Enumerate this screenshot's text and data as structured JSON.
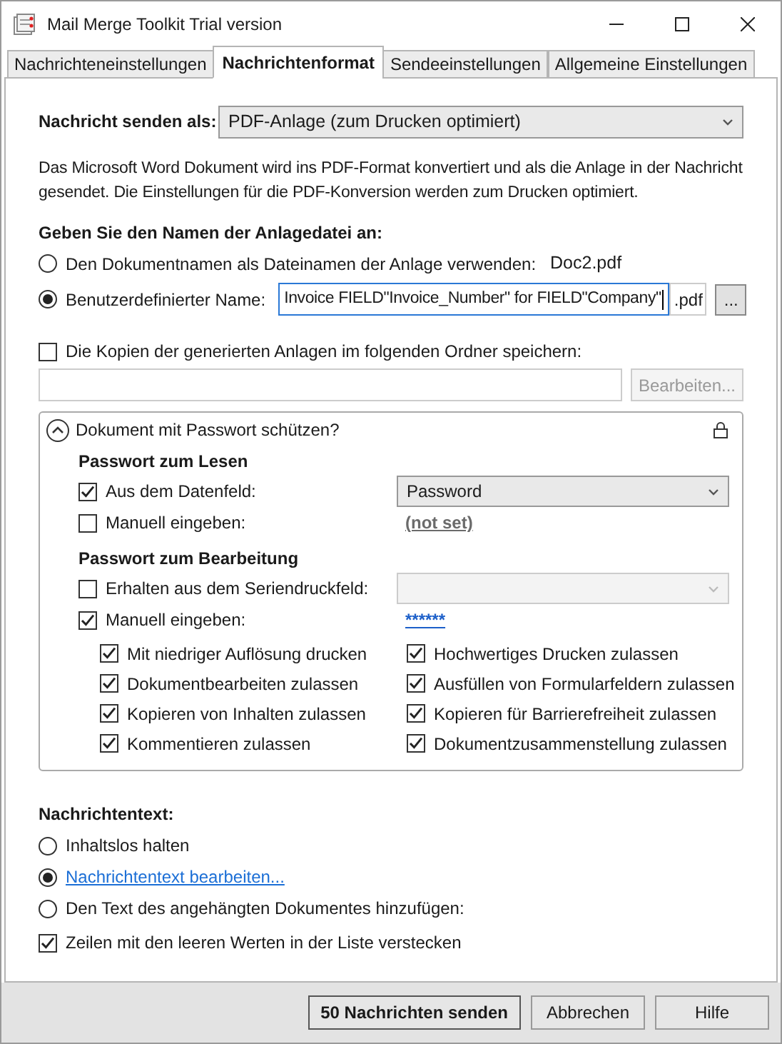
{
  "window": {
    "title": "Mail Merge Toolkit Trial version"
  },
  "tabs": [
    {
      "label": "Nachrichteneinstellungen",
      "selected": false
    },
    {
      "label": "Nachrichtenformat",
      "selected": true
    },
    {
      "label": "Sendeeinstellungen",
      "selected": false
    },
    {
      "label": "Allgemeine Einstellungen",
      "selected": false
    }
  ],
  "send_as": {
    "label": "Nachricht senden als:",
    "value": "PDF-Anlage (zum Drucken optimiert)"
  },
  "description": "Das Microsoft Word Dokument wird ins PDF-Format konvertiert und als die Anlage in der Nachricht gesendet. Die Einstellungen für die PDF-Konversion werden zum Drucken optimiert.",
  "attachment_name": {
    "heading": "Geben Sie den Namen der Anlagedatei an:",
    "options": [
      {
        "kind": "document",
        "label": "Den Dokumentnamen als Dateinamen der Anlage verwenden:",
        "value": "Doc2.pdf",
        "selected": false
      },
      {
        "kind": "custom",
        "label": "Benutzerdefinierter Name:",
        "value": "Invoice FIELD\"Invoice_Number\" for FIELD\"Company\"",
        "extension": ".pdf",
        "button": "...",
        "selected": true
      }
    ]
  },
  "save_copies": {
    "label": "Die Kopien der generierten Anlagen im folgenden Ordner speichern:",
    "checked": false,
    "button": "Bearbeiten...",
    "button_disabled": true
  },
  "password_group": {
    "title": "Dokument mit Passwort schützen?",
    "expanded": true,
    "read": {
      "heading": "Passwort zum Lesen",
      "items": [
        {
          "kind": "dropdown",
          "label": "Aus dem Datenfeld:",
          "checked": true,
          "value": "Password"
        },
        {
          "kind": "link",
          "label": "Manuell eingeben:",
          "checked": false,
          "value": "(not set)"
        }
      ]
    },
    "edit": {
      "heading": "Passwort zum Bearbeitung",
      "items": [
        {
          "kind": "dropdown",
          "label": "Erhalten aus dem Seriendruckfeld:",
          "checked": false,
          "disabled": true
        },
        {
          "kind": "link",
          "label": "Manuell eingeben:",
          "checked": true,
          "value": "******"
        }
      ]
    },
    "permissions": [
      {
        "label": "Mit niedriger Auflösung drucken",
        "checked": true
      },
      {
        "label": "Hochwertiges Drucken zulassen",
        "checked": true
      },
      {
        "label": "Dokumentbearbeiten zulassen",
        "checked": true
      },
      {
        "label": "Ausfüllen von Formularfeldern zulassen",
        "checked": true
      },
      {
        "label": "Kopieren von Inhalten zulassen",
        "checked": true
      },
      {
        "label": "Kopieren für Barrierefreiheit zulassen",
        "checked": true
      },
      {
        "label": "Kommentieren zulassen",
        "checked": true
      },
      {
        "label": "Dokumentzusammenstellung zulassen",
        "checked": true
      }
    ]
  },
  "message_text": {
    "heading": "Nachrichtentext:",
    "options": [
      {
        "kind": "text",
        "label": "Inhaltslos halten",
        "selected": false
      },
      {
        "kind": "link",
        "label": "Nachrichtentext bearbeiten...",
        "selected": true
      },
      {
        "kind": "text",
        "label": "Den Text des angehängten Dokumentes hinzufügen:",
        "selected": false
      }
    ],
    "hide_empty": {
      "label": "Zeilen mit den leeren Werten in der Liste verstecken",
      "checked": true
    }
  },
  "buttons": [
    {
      "label": "50 Nachrichten senden",
      "default": true
    },
    {
      "label": "Abbrechen",
      "default": false
    },
    {
      "label": "Hilfe",
      "default": false
    }
  ]
}
